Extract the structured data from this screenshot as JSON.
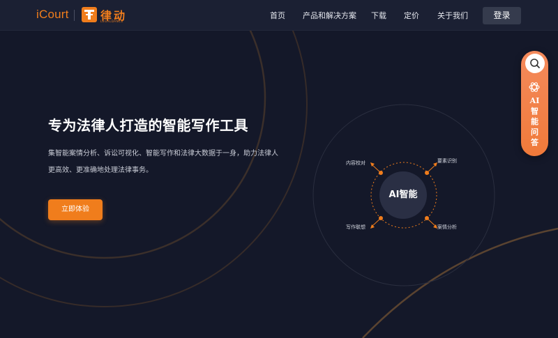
{
  "header": {
    "logo_icourt": "iCourt",
    "logo_legaldance": "律动",
    "logo_legaldance_sub": "LEGALDANCE",
    "nav": [
      "首页",
      "产品和解决方案",
      "下载",
      "定价",
      "关于我们"
    ],
    "login_label": "登录"
  },
  "hero": {
    "title": "专为法律人打造的智能写作工具",
    "description": "集智能案情分析、诉讼可视化、智能写作和法律大数据于一身，助力法律人更高效、更准确地处理法律事务。",
    "cta_label": "立即体验"
  },
  "diagram": {
    "center": "AI智能",
    "labels": {
      "top_left": "内容校对",
      "top_right": "要素识别",
      "bottom_left": "写作联想",
      "bottom_right": "案情分析"
    }
  },
  "side_widget": {
    "label_chars": [
      "AI",
      "智",
      "能",
      "问",
      "答"
    ],
    "search_icon": "search-icon",
    "ai_icon": "openai-icon"
  },
  "colors": {
    "accent": "#f07d1c",
    "background": "#141829",
    "header": "#1b2033"
  }
}
